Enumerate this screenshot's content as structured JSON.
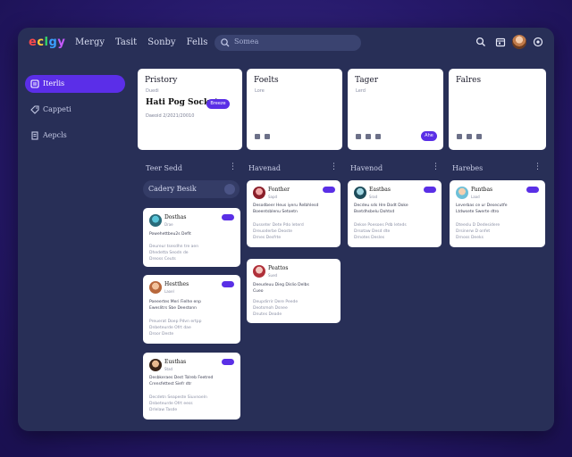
{
  "app": {
    "logo": "eclgy",
    "logo_colors": [
      "#ff4a4a",
      "#ffd23a",
      "#36d66a",
      "#3aa0ff",
      "#c65bff"
    ]
  },
  "nav": [
    "Mergy",
    "Tasit",
    "Sonby",
    "Fells"
  ],
  "search": {
    "placeholder": "Somea"
  },
  "topbar_icons": [
    "search-icon",
    "calendar-icon",
    "user-avatar",
    "settings-icon"
  ],
  "sidebar": {
    "items": [
      {
        "label": "Iterlis",
        "icon": "board-icon",
        "active": true
      },
      {
        "label": "Cappeti",
        "icon": "tag-icon",
        "active": false
      },
      {
        "label": "Aepcls",
        "icon": "doc-icon",
        "active": false
      }
    ],
    "footer_icon": "spark-icon"
  },
  "stats": [
    {
      "title": "Pristory",
      "sub": "Duedi",
      "big": "Hati Pog Socket",
      "meta": "Daeoid  2/2021/20010",
      "button": "Breeze"
    },
    {
      "title": "Foelts",
      "sub": "Lore"
    },
    {
      "title": "Tager",
      "sub": "Lerd",
      "button": "Ahe"
    },
    {
      "title": "Falres",
      "sub": ""
    }
  ],
  "columns": [
    {
      "title": "Teer Sedd"
    },
    {
      "title": "Havenad"
    },
    {
      "title": "Havenod"
    },
    {
      "title": "Harebes"
    }
  ],
  "category_filter": {
    "label": "Cadery Besik"
  },
  "cards": [
    {
      "name": "Dosthas",
      "sub": "Drae",
      "lines": [
        "Powehettbeu2s Defit"
      ],
      "gray": [
        "Deureur tsesdhn tre aen",
        "Dhedetta Seodn de",
        "Dreoss Ceuts"
      ]
    },
    {
      "name": "Hestthes",
      "sub": "Laoel",
      "lines": [
        "Poeeertes Meri Fielhe enp",
        "Eweslitrs Sbe Deestonn"
      ],
      "gray": [
        "Preuerat Doep Pdvn ertpp",
        "Dnbeteurde Ofrt dae",
        "Droor Deste"
      ]
    },
    {
      "name": "Eusthas",
      "sub": "Stad",
      "lines": [
        "Desbkeraes Dest Tolreb Feetred",
        "Crensfettest Siefr dtr"
      ],
      "gray": [
        "Decdetn Seapeste Siuvnoeln",
        "Dnbeteurde Ofrt eess",
        "Drlelaw Tasde"
      ]
    },
    {
      "name": "Fonther",
      "sub": "Sapd",
      "lines": [
        "Desodbeer Heus iyeru Relbhlesd",
        "Boeentsblenu Setoetn"
      ],
      "gray": [
        "Dusseter Dete Pdo leterd",
        "Dreuoderbe Deoste",
        "Drnes Desfrte"
      ]
    },
    {
      "name": "Peattos",
      "sub": "Sued",
      "lines": [
        "Deeudeuu Dieg Dislio Delbs",
        "Cueo"
      ],
      "gray": [
        "Deupdirrir Dere Peede",
        "Deotsmoh Dsnee",
        "Dnutes Deade"
      ]
    },
    {
      "name": "Eastbas",
      "sub": "Srad",
      "lines": [
        "Decdeu sds Hre Dodt Doke",
        "Bsetdhsbelu Dohtsd"
      ],
      "gray": [
        "Dekse Poesoes Pdb leteds",
        "Drsotaw Desd dte",
        "Drnotes Desles"
      ]
    },
    {
      "name": "Pantbas",
      "sub": "Laad",
      "lines": [
        "Leverbas ce ur Desecutfe",
        "Ltdwsete Swerte dtro"
      ],
      "gray": [
        "Dteeslu D Dedesidere",
        "Drsinerw D onfet",
        "Drnoss Deeks"
      ]
    }
  ]
}
